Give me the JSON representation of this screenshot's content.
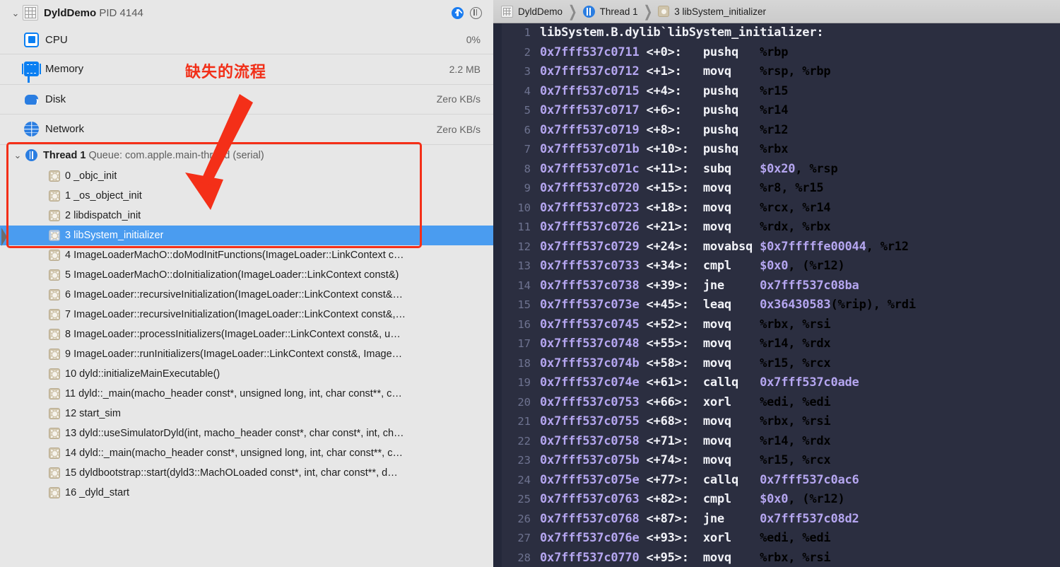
{
  "left": {
    "process": {
      "name": "DyldDemo",
      "pid_label": "PID 4144",
      "disclosure": "⌄",
      "info_icon": "info-icon",
      "pause_icon": "pause-icon"
    },
    "resources": [
      {
        "icon": "cpu-icon",
        "label": "CPU",
        "value": "0%"
      },
      {
        "icon": "memory-icon",
        "label": "Memory",
        "value": "2.2 MB"
      },
      {
        "icon": "disk-icon",
        "label": "Disk",
        "value": "Zero KB/s"
      },
      {
        "icon": "network-icon",
        "label": "Network",
        "value": "Zero KB/s"
      }
    ],
    "thread": {
      "disclosure": "⌄",
      "name": "Thread 1",
      "queue": "Queue: com.apple.main-thread (serial)"
    },
    "frames": [
      {
        "text": "0 _objc_init",
        "selected": false
      },
      {
        "text": "1 _os_object_init",
        "selected": false
      },
      {
        "text": "2 libdispatch_init",
        "selected": false
      },
      {
        "text": "3 libSystem_initializer",
        "selected": true
      },
      {
        "text": "4 ImageLoaderMachO::doModInitFunctions(ImageLoader::LinkContext c…",
        "selected": false
      },
      {
        "text": "5 ImageLoaderMachO::doInitialization(ImageLoader::LinkContext const&)",
        "selected": false
      },
      {
        "text": "6 ImageLoader::recursiveInitialization(ImageLoader::LinkContext const&…",
        "selected": false
      },
      {
        "text": "7 ImageLoader::recursiveInitialization(ImageLoader::LinkContext const&,…",
        "selected": false
      },
      {
        "text": "8 ImageLoader::processInitializers(ImageLoader::LinkContext const&, u…",
        "selected": false
      },
      {
        "text": "9 ImageLoader::runInitializers(ImageLoader::LinkContext const&, Image…",
        "selected": false
      },
      {
        "text": "10 dyld::initializeMainExecutable()",
        "selected": false
      },
      {
        "text": "11 dyld::_main(macho_header const*, unsigned long, int, char const**, c…",
        "selected": false
      },
      {
        "text": "12 start_sim",
        "selected": false
      },
      {
        "text": "13 dyld::useSimulatorDyld(int, macho_header const*, char const*, int, ch…",
        "selected": false
      },
      {
        "text": "14 dyld::_main(macho_header const*, unsigned long, int, char const**, c…",
        "selected": false
      },
      {
        "text": "15 dyldbootstrap::start(dyld3::MachOLoaded const*, int, char const**, d…",
        "selected": false
      },
      {
        "text": "16 _dyld_start",
        "selected": false
      }
    ]
  },
  "annotations": {
    "note_text": "缺失的流程",
    "note_color": "#f42f18",
    "box_color": "#f42f18",
    "arrow_color": "#f42f18"
  },
  "right": {
    "breadcrumb": [
      {
        "icon": "process-icon",
        "label": "DyldDemo"
      },
      {
        "icon": "thread-icon",
        "label": "Thread 1"
      },
      {
        "icon": "frame-icon",
        "label": "3 libSystem_initializer"
      }
    ],
    "separator": "❯",
    "code_title": "libSystem.B.dylib`libSystem_initializer:",
    "lines": [
      {
        "n": "1",
        "addr": "",
        "off": "",
        "mn": "",
        "ops": ""
      },
      {
        "n": "2",
        "addr": "0x7fff537c0711",
        "off": "<+0>:",
        "mn": "pushq",
        "ops": "%rbp"
      },
      {
        "n": "3",
        "addr": "0x7fff537c0712",
        "off": "<+1>:",
        "mn": "movq",
        "ops": "%rsp, %rbp"
      },
      {
        "n": "4",
        "addr": "0x7fff537c0715",
        "off": "<+4>:",
        "mn": "pushq",
        "ops": "%r15"
      },
      {
        "n": "5",
        "addr": "0x7fff537c0717",
        "off": "<+6>:",
        "mn": "pushq",
        "ops": "%r14"
      },
      {
        "n": "6",
        "addr": "0x7fff537c0719",
        "off": "<+8>:",
        "mn": "pushq",
        "ops": "%r12"
      },
      {
        "n": "7",
        "addr": "0x7fff537c071b",
        "off": "<+10>:",
        "mn": "pushq",
        "ops": "%rbx"
      },
      {
        "n": "8",
        "addr": "0x7fff537c071c",
        "off": "<+11>:",
        "mn": "subq",
        "ops": "$0x20, %rsp"
      },
      {
        "n": "9",
        "addr": "0x7fff537c0720",
        "off": "<+15>:",
        "mn": "movq",
        "ops": "%r8, %r15"
      },
      {
        "n": "10",
        "addr": "0x7fff537c0723",
        "off": "<+18>:",
        "mn": "movq",
        "ops": "%rcx, %r14"
      },
      {
        "n": "11",
        "addr": "0x7fff537c0726",
        "off": "<+21>:",
        "mn": "movq",
        "ops": "%rdx, %rbx"
      },
      {
        "n": "12",
        "addr": "0x7fff537c0729",
        "off": "<+24>:",
        "mn": "movabsq",
        "ops": "$0x7fffffe00044, %r12"
      },
      {
        "n": "13",
        "addr": "0x7fff537c0733",
        "off": "<+34>:",
        "mn": "cmpl",
        "ops": "$0x0, (%r12)"
      },
      {
        "n": "14",
        "addr": "0x7fff537c0738",
        "off": "<+39>:",
        "mn": "jne",
        "ops": "0x7fff537c08ba"
      },
      {
        "n": "15",
        "addr": "0x7fff537c073e",
        "off": "<+45>:",
        "mn": "leaq",
        "ops": "0x36430583(%rip), %rdi"
      },
      {
        "n": "16",
        "addr": "0x7fff537c0745",
        "off": "<+52>:",
        "mn": "movq",
        "ops": "%rbx, %rsi"
      },
      {
        "n": "17",
        "addr": "0x7fff537c0748",
        "off": "<+55>:",
        "mn": "movq",
        "ops": "%r14, %rdx"
      },
      {
        "n": "18",
        "addr": "0x7fff537c074b",
        "off": "<+58>:",
        "mn": "movq",
        "ops": "%r15, %rcx"
      },
      {
        "n": "19",
        "addr": "0x7fff537c074e",
        "off": "<+61>:",
        "mn": "callq",
        "ops": "0x7fff537c0ade"
      },
      {
        "n": "20",
        "addr": "0x7fff537c0753",
        "off": "<+66>:",
        "mn": "xorl",
        "ops": "%edi, %edi"
      },
      {
        "n": "21",
        "addr": "0x7fff537c0755",
        "off": "<+68>:",
        "mn": "movq",
        "ops": "%rbx, %rsi"
      },
      {
        "n": "22",
        "addr": "0x7fff537c0758",
        "off": "<+71>:",
        "mn": "movq",
        "ops": "%r14, %rdx"
      },
      {
        "n": "23",
        "addr": "0x7fff537c075b",
        "off": "<+74>:",
        "mn": "movq",
        "ops": "%r15, %rcx"
      },
      {
        "n": "24",
        "addr": "0x7fff537c075e",
        "off": "<+77>:",
        "mn": "callq",
        "ops": "0x7fff537c0ac6"
      },
      {
        "n": "25",
        "addr": "0x7fff537c0763",
        "off": "<+82>:",
        "mn": "cmpl",
        "ops": "$0x0, (%r12)"
      },
      {
        "n": "26",
        "addr": "0x7fff537c0768",
        "off": "<+87>:",
        "mn": "jne",
        "ops": "0x7fff537c08d2"
      },
      {
        "n": "27",
        "addr": "0x7fff537c076e",
        "off": "<+93>:",
        "mn": "xorl",
        "ops": "%edi, %edi"
      },
      {
        "n": "28",
        "addr": "0x7fff537c0770",
        "off": "<+95>:",
        "mn": "movq",
        "ops": "%rbx, %rsi"
      }
    ]
  }
}
